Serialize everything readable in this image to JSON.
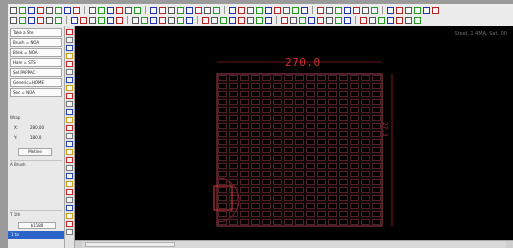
{
  "left_panel": {
    "commands": [
      "Take a Ste",
      "Brush = NOA",
      "Blink = NOA",
      "Ham = STS",
      "Sel.PAPPAC",
      "Generic=HOME",
      "Sec = NOA"
    ],
    "properties_title": "Wrap",
    "coords": [
      {
        "label": "X:",
        "value": "280.00"
      },
      {
        "label": "Y:",
        "value": "180.0"
      }
    ],
    "mode_button": "Metine",
    "section_label": "A Brush",
    "bottom_label": "T 1th",
    "value_box": "$1180",
    "selected_item": "1 to"
  },
  "canvas": {
    "status_text": "Steel, 1 4MA, Sat. 00",
    "dimension_top": "270.0",
    "dimension_right": "27.3",
    "grid_color": "#c85060",
    "dimension_color": "#d03030"
  }
}
